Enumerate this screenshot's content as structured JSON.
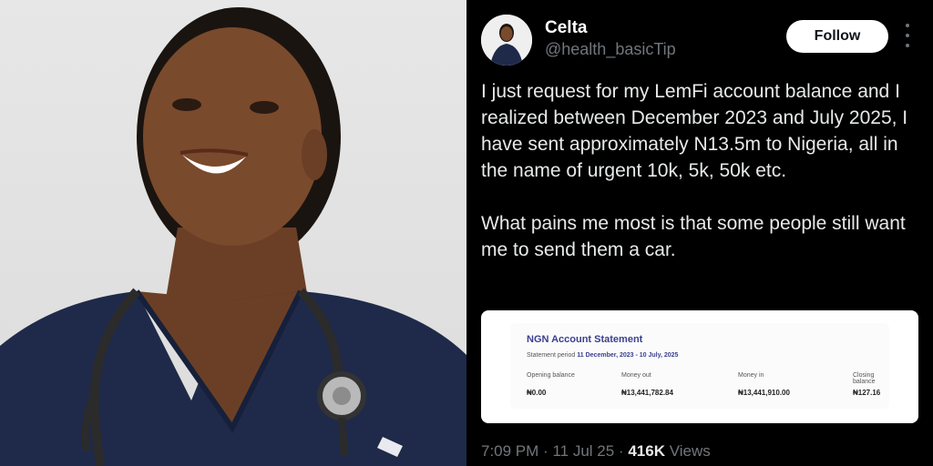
{
  "tweet": {
    "author_name": "Celta",
    "author_handle": "@health_basicTip",
    "follow_label": "Follow",
    "paragraph_1": "I just request for my LemFi account balance and I realized between December 2023 and July 2025, I have sent approximately N13.5m to Nigeria, all in the name of urgent 10k, 5k, 50k etc.",
    "paragraph_2": "What pains me most is that some people still want me to send them a car.",
    "time": "7:09 PM",
    "date": "11 Jul 25",
    "separator": "·",
    "views_count": "416K",
    "views_label": "Views"
  },
  "statement": {
    "title": "NGN Account Statement",
    "period_label": "Statement period",
    "period_value": "11 December, 2023 - 10 July, 2025",
    "columns": [
      {
        "label": "Opening balance",
        "value": "₦0.00"
      },
      {
        "label": "Money out",
        "value": "₦13,441,782.84"
      },
      {
        "label": "Money in",
        "value": "₦13,441,910.00"
      },
      {
        "label": "Closing balance",
        "value": "₦127.16"
      }
    ]
  },
  "colors": {
    "background": "#000000",
    "text_primary": "#e7e9ea",
    "text_secondary": "#71767b",
    "scrubs_navy": "#1f2a4a"
  },
  "icons": [
    "more-options-icon",
    "stethoscope-icon"
  ]
}
